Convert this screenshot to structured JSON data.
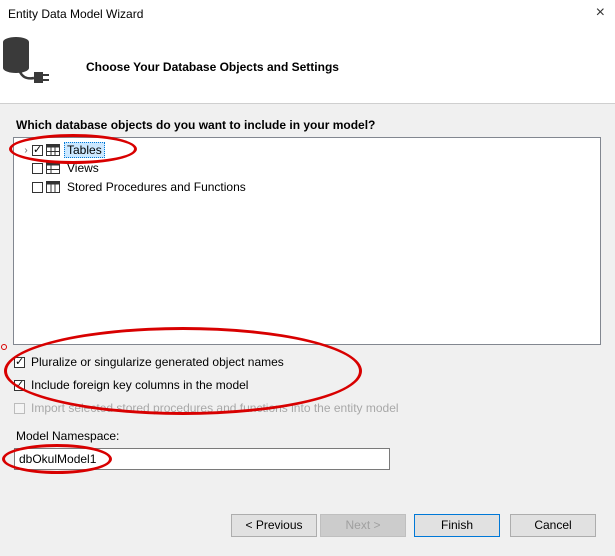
{
  "window": {
    "title": "Entity Data Model Wizard",
    "close_glyph": "×"
  },
  "header": {
    "title": "Choose Your Database Objects and Settings",
    "icon": "database-plug-icon"
  },
  "question": "Which database objects do you want to include in your model?",
  "tree": {
    "items": [
      {
        "label": "Tables",
        "checked": true,
        "expanded": false,
        "selected": true
      },
      {
        "label": "Views",
        "checked": false,
        "expanded": false,
        "selected": false
      },
      {
        "label": "Stored Procedures and Functions",
        "checked": false,
        "expanded": false,
        "selected": false
      }
    ],
    "expander_glyph": "›"
  },
  "options": {
    "pluralize": {
      "label": "Pluralize or singularize generated object names",
      "checked": true
    },
    "foreign_keys": {
      "label": "Include foreign key columns in the model",
      "checked": true
    },
    "import_procs": {
      "label": "Import selected stored procedures and functions into the entity model",
      "checked": false,
      "disabled": true
    }
  },
  "namespace": {
    "label": "Model Namespace:",
    "value": "dbOkulModel1"
  },
  "buttons": {
    "previous": "< Previous",
    "next": "Next >",
    "finish": "Finish",
    "cancel": "Cancel"
  },
  "annotation_color": "#d80000"
}
